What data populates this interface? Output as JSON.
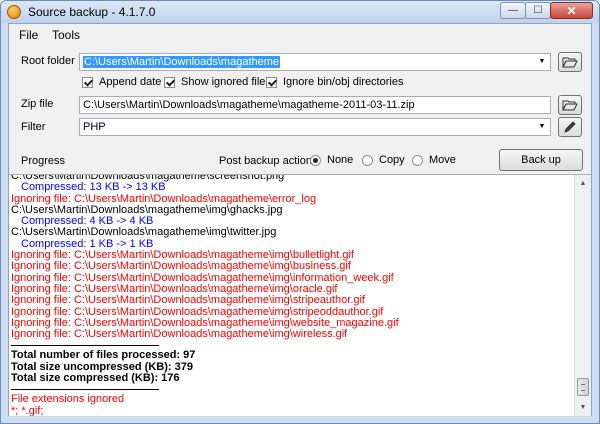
{
  "window": {
    "title": "Source backup - 4.1.7.0",
    "controls": {
      "minimize": "—",
      "maximize": "☐",
      "close": "✕"
    }
  },
  "menu": [
    {
      "label": "File"
    },
    {
      "label": "Tools"
    }
  ],
  "root_folder": {
    "label": "Root folder",
    "value": "C:\\Users\\Martin\\Downloads\\magatheme",
    "browse_icon": "folder-open-icon"
  },
  "options": [
    {
      "label": "Append date",
      "checked": true
    },
    {
      "label": "Show ignored files",
      "checked": true
    },
    {
      "label": "Ignore bin/obj directories",
      "checked": true
    }
  ],
  "zip_file": {
    "label": "Zip file",
    "value": "C:\\Users\\Martin\\Downloads\\magatheme\\magatheme-2011-03-11.zip",
    "browse_icon": "folder-open-icon"
  },
  "filter": {
    "label": "Filter",
    "value": "PHP",
    "edit_icon": "pencil-icon"
  },
  "progress_label": "Progress",
  "post_backup": {
    "label": "Post backup action",
    "options": [
      {
        "label": "None",
        "selected": true
      },
      {
        "label": "Copy",
        "selected": false
      },
      {
        "label": "Move",
        "selected": false
      }
    ]
  },
  "backup_button": "Back up",
  "log": {
    "lines": [
      {
        "text": "C:\\Users\\Martin\\Downloads\\magatheme\\screenshot.png",
        "style": "black"
      },
      {
        "text": "Compressed: 13 KB -> 13 KB",
        "style": "blue"
      },
      {
        "text": "Ignoring file: C:\\Users\\Martin\\Downloads\\magatheme\\error_log",
        "style": "red"
      },
      {
        "text": "C:\\Users\\Martin\\Downloads\\magatheme\\img\\ghacks.jpg",
        "style": "black"
      },
      {
        "text": "Compressed: 4 KB -> 4 KB",
        "style": "blue"
      },
      {
        "text": "C:\\Users\\Martin\\Downloads\\magatheme\\img\\twitter.jpg",
        "style": "black"
      },
      {
        "text": "Compressed: 1 KB -> 1 KB",
        "style": "blue"
      },
      {
        "text": "Ignoring file: C:\\Users\\Martin\\Downloads\\magatheme\\img\\bulletlight.gif",
        "style": "red"
      },
      {
        "text": "Ignoring file: C:\\Users\\Martin\\Downloads\\magatheme\\img\\business.gif",
        "style": "red"
      },
      {
        "text": "Ignoring file: C:\\Users\\Martin\\Downloads\\magatheme\\img\\information_week.gif",
        "style": "red"
      },
      {
        "text": "Ignoring file: C:\\Users\\Martin\\Downloads\\magatheme\\img\\oracle.gif",
        "style": "red"
      },
      {
        "text": "Ignoring file: C:\\Users\\Martin\\Downloads\\magatheme\\img\\stripeauthor.gif",
        "style": "red"
      },
      {
        "text": "Ignoring file: C:\\Users\\Martin\\Downloads\\magatheme\\img\\stripeoddauthor.gif",
        "style": "red"
      },
      {
        "text": "Ignoring file: C:\\Users\\Martin\\Downloads\\magatheme\\img\\website_magazine.gif",
        "style": "red"
      },
      {
        "text": "Ignoring file: C:\\Users\\Martin\\Downloads\\magatheme\\img\\wireless.gif",
        "style": "red"
      }
    ],
    "summary": [
      "Total number of files processed: 97",
      "Total size uncompressed (KB): 379",
      "Total size compressed (KB): 176"
    ],
    "footer": [
      "File extensions ignored",
      "*; *.gif;"
    ]
  },
  "colors": {
    "log_blue": "#0000ff",
    "log_red": "#ff0000",
    "selection": "#3399ff"
  }
}
